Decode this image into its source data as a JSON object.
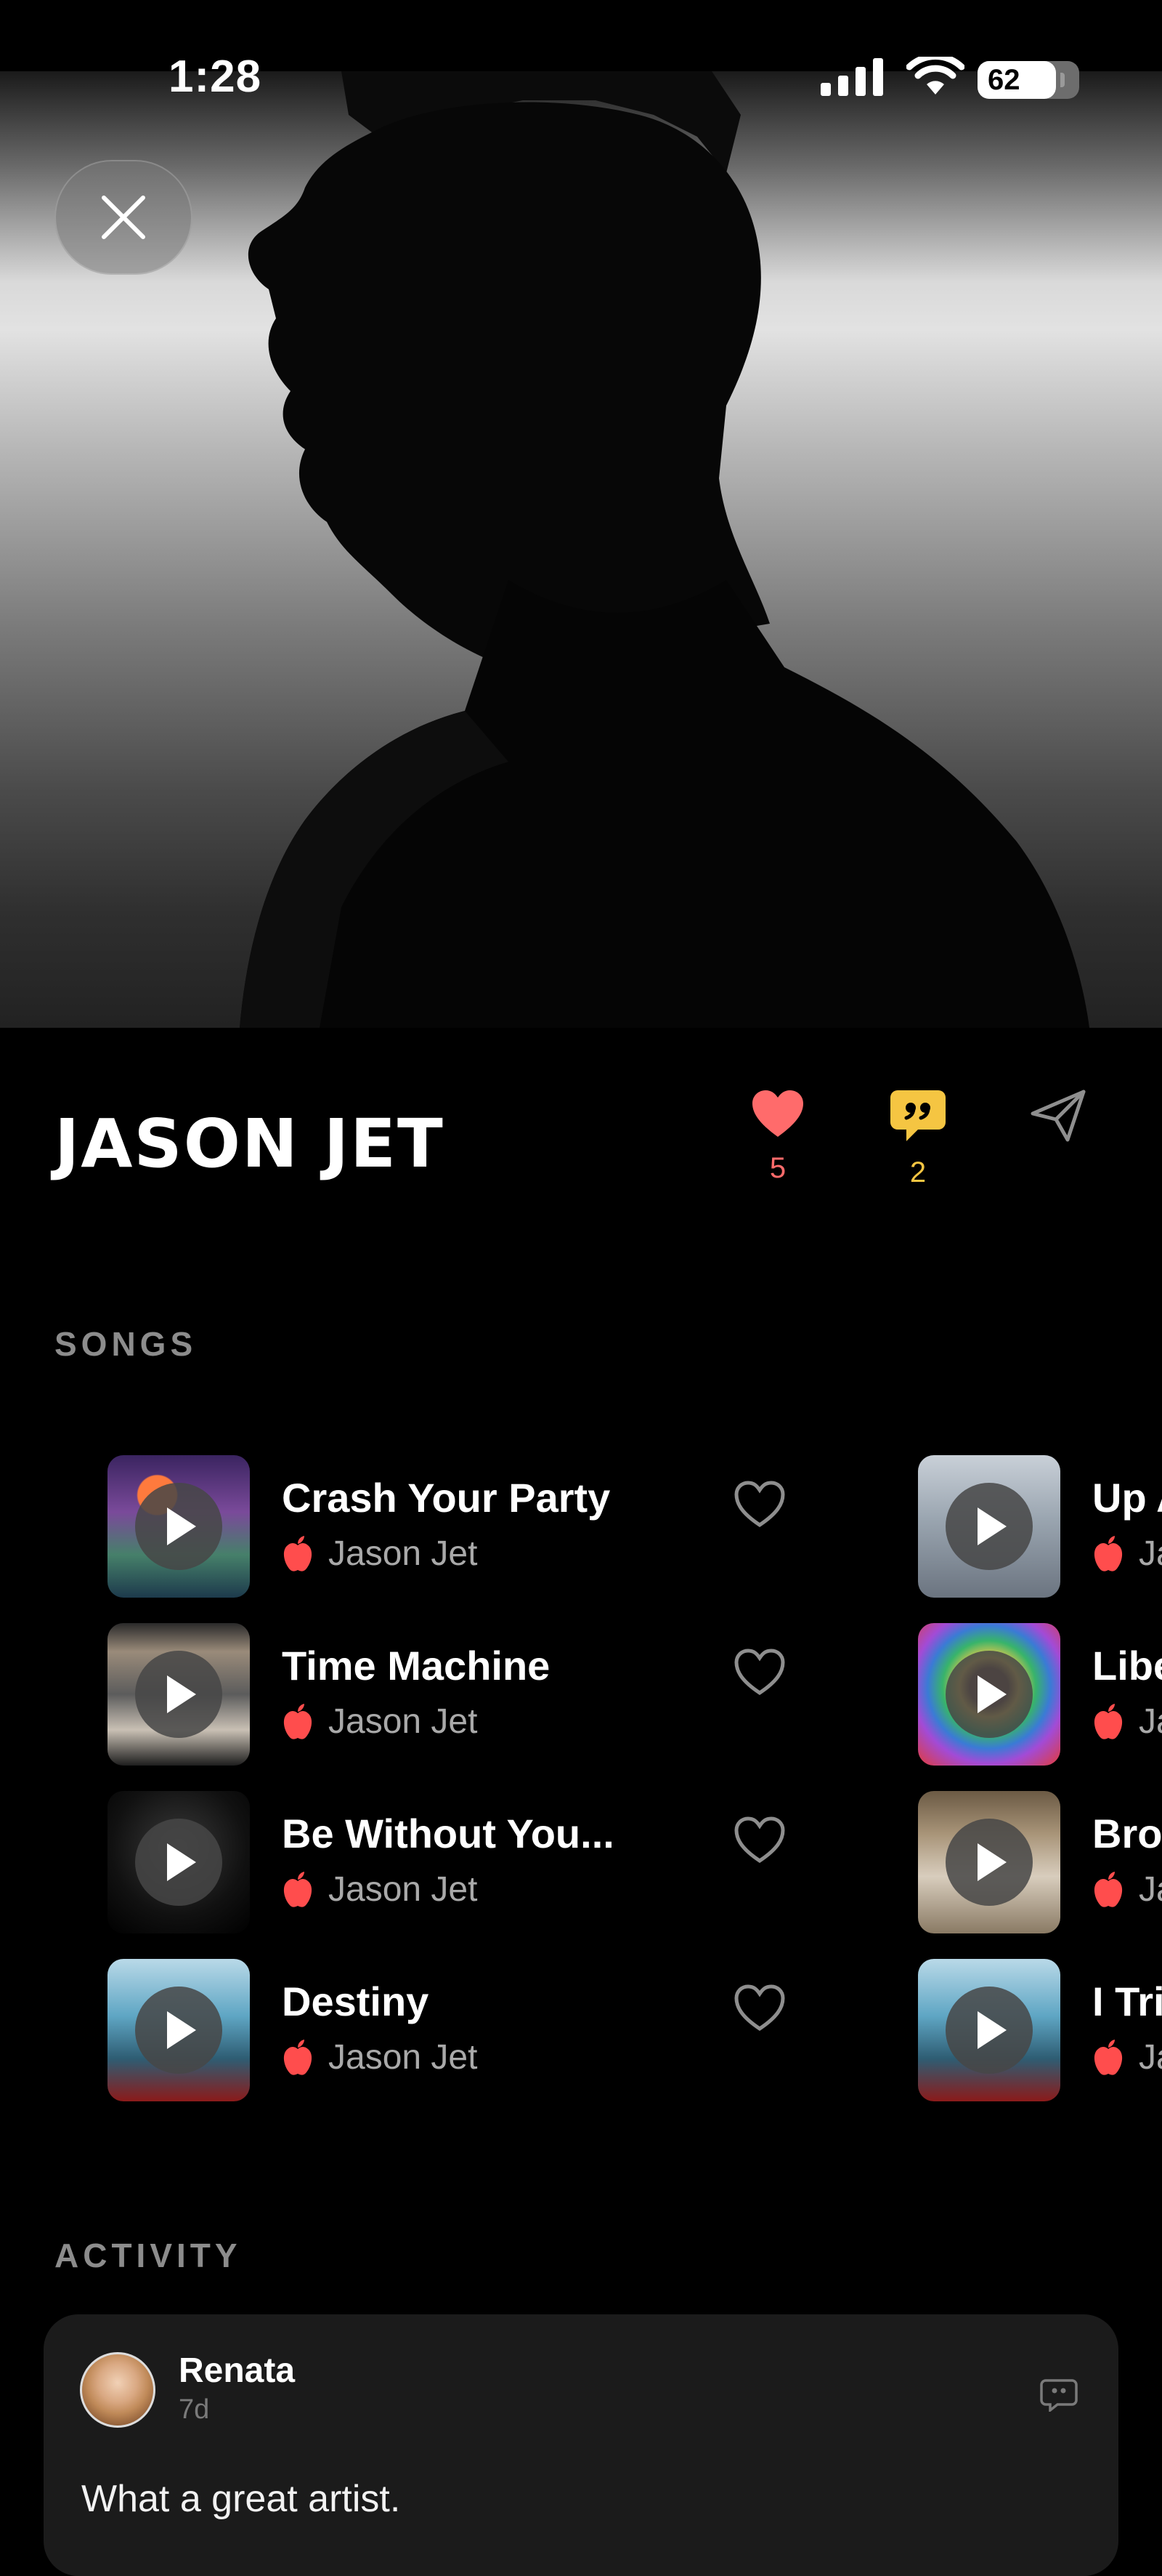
{
  "status_bar": {
    "time": "1:28",
    "battery": "62"
  },
  "artist": {
    "name": "JASON JET"
  },
  "actions": {
    "likes": "5",
    "comments": "2"
  },
  "colors": {
    "like": "#ff6b6b",
    "comment": "#f5c542",
    "apple": "#ff4d4d"
  },
  "sections": {
    "songs": "SONGS",
    "activity": "ACTIVITY"
  },
  "songs_col1": [
    {
      "title": "Crash Your Party",
      "artist": "Jason Jet"
    },
    {
      "title": "Time Machine",
      "artist": "Jason Jet"
    },
    {
      "title": "Be Without You...",
      "artist": "Jason Jet"
    },
    {
      "title": "Destiny",
      "artist": "Jason Jet"
    }
  ],
  "songs_col2": [
    {
      "title": "Up A",
      "artist": "Ja"
    },
    {
      "title": "Libe",
      "artist": "Ja"
    },
    {
      "title": "Brol",
      "artist": "Ja"
    },
    {
      "title": "I Tri",
      "artist": "Ja"
    }
  ],
  "activity": {
    "user": "Renata",
    "time": "7d",
    "text": "What a great artist."
  }
}
